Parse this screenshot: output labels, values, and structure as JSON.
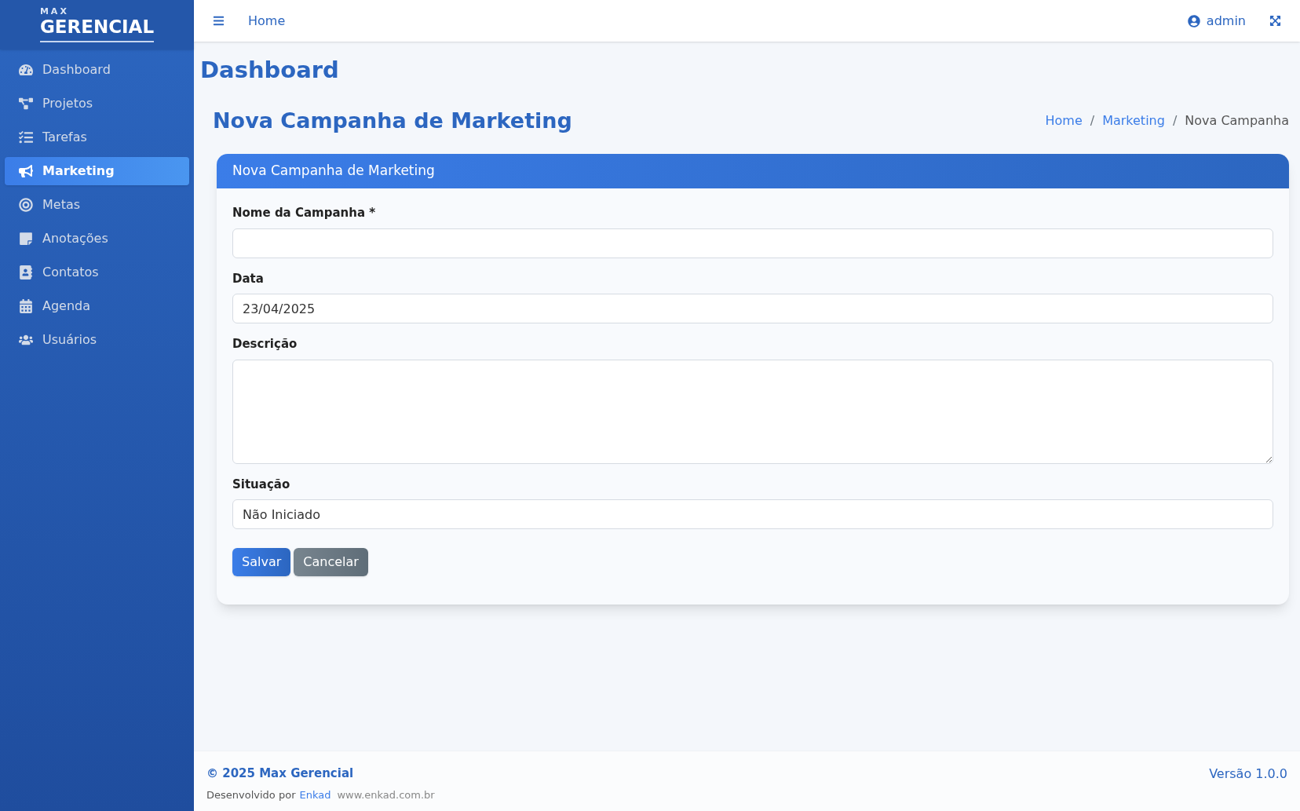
{
  "brand": {
    "small": "MAX",
    "large": "GERENCIAL"
  },
  "sidebar": {
    "items": [
      {
        "label": "Dashboard",
        "selected": false
      },
      {
        "label": "Projetos",
        "selected": false
      },
      {
        "label": "Tarefas",
        "selected": false
      },
      {
        "label": "Marketing",
        "selected": true
      },
      {
        "label": "Metas",
        "selected": false
      },
      {
        "label": "Anotações",
        "selected": false
      },
      {
        "label": "Contatos",
        "selected": false
      },
      {
        "label": "Agenda",
        "selected": false
      },
      {
        "label": "Usuários",
        "selected": false
      }
    ]
  },
  "topbar": {
    "link": "Home",
    "user": "admin"
  },
  "page_heading": "Dashboard",
  "title": "Nova Campanha de Marketing",
  "breadcrumb": [
    {
      "label": "Home",
      "kind": "link"
    },
    {
      "label": "/",
      "kind": "separator"
    },
    {
      "label": "Marketing",
      "kind": "link"
    },
    {
      "label": "/",
      "kind": "separator"
    },
    {
      "label": "Nova Campanha",
      "kind": "current"
    }
  ],
  "card": {
    "header": "Nova Campanha de Marketing",
    "fields": [
      {
        "label": "Nome da Campanha *",
        "kind": "text"
      },
      {
        "label": "Data",
        "kind": "text",
        "value": "23/04/2025"
      },
      {
        "label": "Descrição",
        "kind": "textarea"
      },
      {
        "label": "Situação",
        "kind": "text",
        "value": "Não Iniciado"
      }
    ],
    "buttons": [
      {
        "label": "Salvar",
        "kind": "primary"
      },
      {
        "label": "Cancelar",
        "kind": "secondary"
      }
    ]
  },
  "footer": {
    "copyright": "© 2025 Max Gerencial",
    "developed_by": "Desenvolvido por",
    "developer": "Enkad",
    "website": "www.enkad.com.br",
    "version": "Versão 1.0.0"
  }
}
